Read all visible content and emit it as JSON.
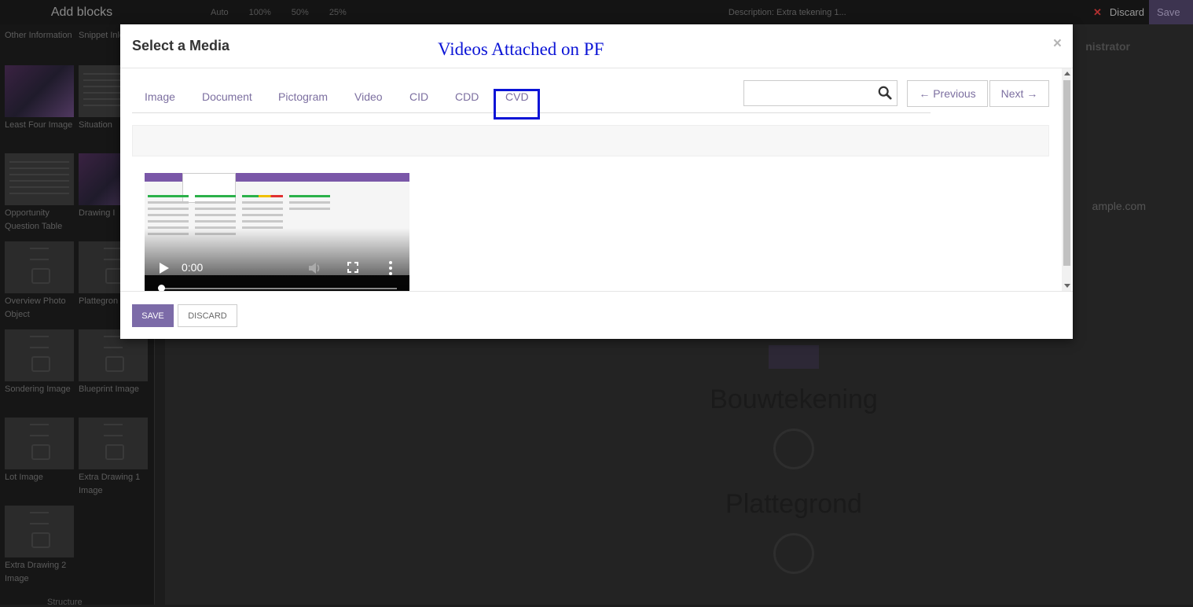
{
  "editor": {
    "panel_title": "Add blocks",
    "toolbar_items": [
      "Auto",
      "100%",
      "50%",
      "25%"
    ],
    "description": "Description: Extra tekening 1...",
    "discard_label": "Discard",
    "save_label": "Save",
    "structure_label": "Structure",
    "admin_label": "nistrator",
    "email_fragment": "ample.com",
    "headings": [
      "Bouwtekening",
      "Plattegrond"
    ]
  },
  "sidebar_blocks": [
    {
      "label": "Other Information"
    },
    {
      "label": "Snippet Inleiding"
    },
    {
      "label": "Least Four Image"
    },
    {
      "label": "Situation"
    },
    {
      "label": "Opportunity Question Table"
    },
    {
      "label": "Drawing I"
    },
    {
      "label": "Overview Photo Object"
    },
    {
      "label": "Plattegron Image"
    },
    {
      "label": "Sondering Image"
    },
    {
      "label": "Blueprint Image"
    },
    {
      "label": "Lot Image"
    },
    {
      "label": "Extra Drawing 1 Image"
    },
    {
      "label": "Extra Drawing 2 Image"
    }
  ],
  "modal": {
    "title": "Select a Media",
    "annotation": "Videos Attached on PF",
    "close": "×",
    "tabs": [
      "Image",
      "Document",
      "Pictogram",
      "Video",
      "CID",
      "CDD",
      "CVD"
    ],
    "active_tab": "CVD",
    "search": {
      "value": "",
      "placeholder": ""
    },
    "prev_label": "← Previous",
    "next_label": "Next →",
    "video": {
      "time": "0:00",
      "progress": 0.0
    },
    "save_label": "SAVE",
    "discard_label": "DISCARD"
  },
  "colors": {
    "accent": "#7c6ba8",
    "annotation": "#0b14d6",
    "tab_text": "#7c6fa0"
  }
}
